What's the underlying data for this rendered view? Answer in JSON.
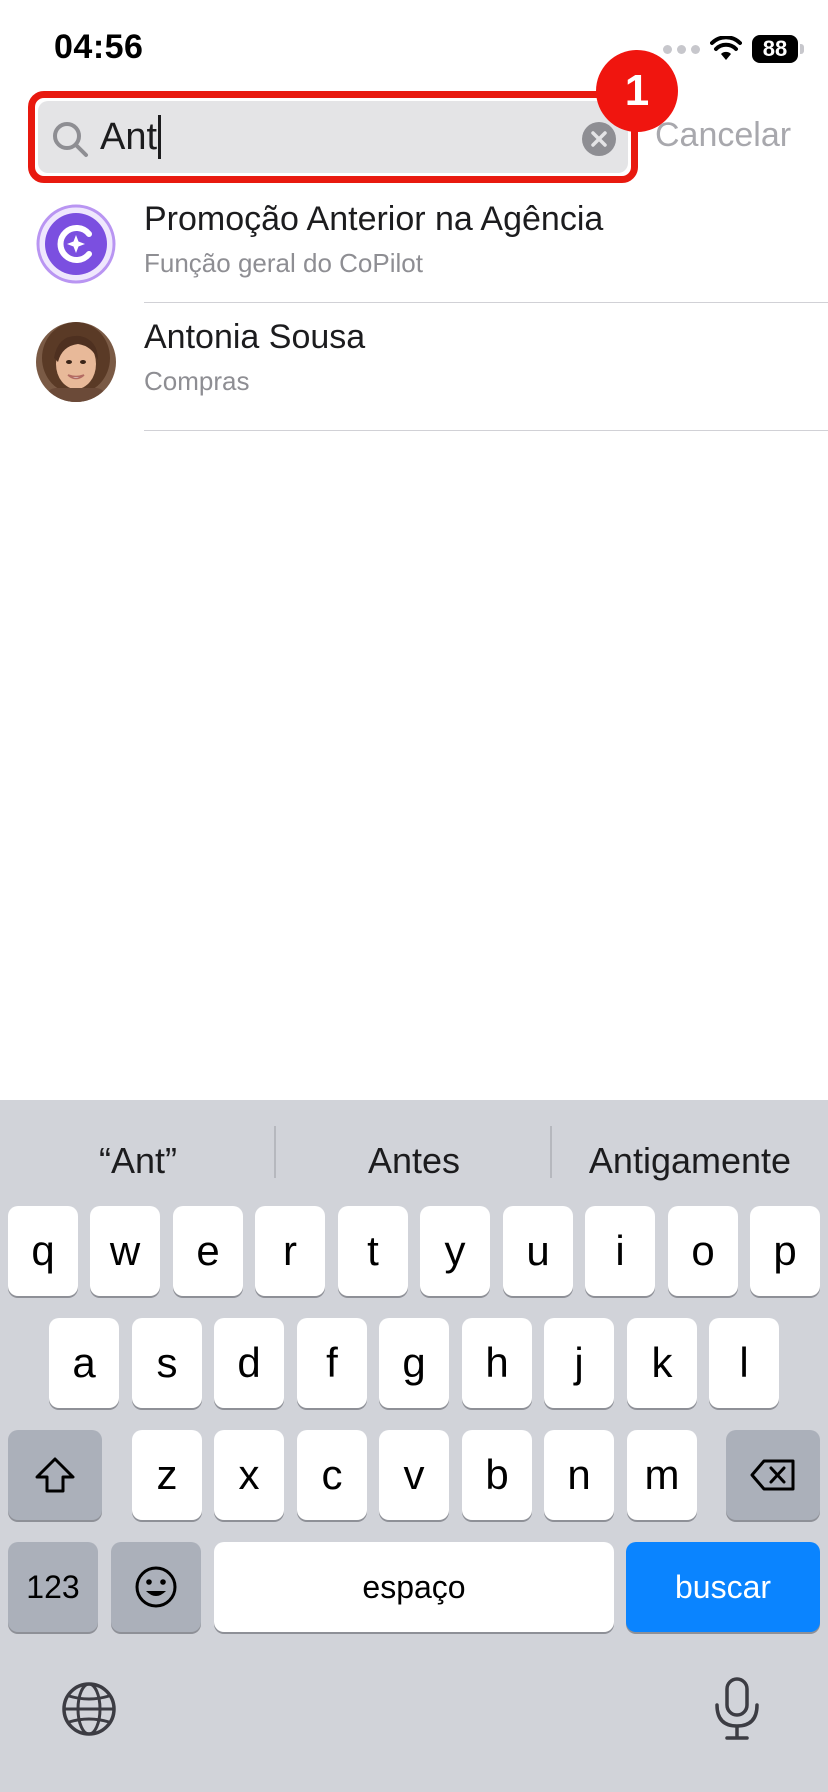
{
  "status_bar": {
    "time": "04:56",
    "battery": "88"
  },
  "search": {
    "query": "Ant",
    "cancel_label": "Cancelar",
    "highlight_color": "#e8190f"
  },
  "annotation": {
    "step_number": "1"
  },
  "results": [
    {
      "title": "Promoção Anterior na Agência",
      "subtitle": "Função geral do CoPilot",
      "icon": "copilot-icon",
      "accent": "#7b4fe0"
    },
    {
      "title": "Antonia Sousa",
      "subtitle": "Compras",
      "icon": "person-avatar"
    }
  ],
  "keyboard": {
    "suggestions": [
      "“Ant”",
      "Antes",
      "Antigamente"
    ],
    "row1": [
      "q",
      "w",
      "e",
      "r",
      "t",
      "y",
      "u",
      "i",
      "o",
      "p"
    ],
    "row2": [
      "a",
      "s",
      "d",
      "f",
      "g",
      "h",
      "j",
      "k",
      "l"
    ],
    "row3": [
      "z",
      "x",
      "c",
      "v",
      "b",
      "n",
      "m"
    ],
    "numbers_label": "123",
    "space_label": "espaço",
    "search_label": "buscar",
    "accent_color": "#0a84ff",
    "icons": [
      "shift-icon",
      "backspace-icon",
      "emoji-icon",
      "globe-icon",
      "microphone-icon"
    ]
  }
}
